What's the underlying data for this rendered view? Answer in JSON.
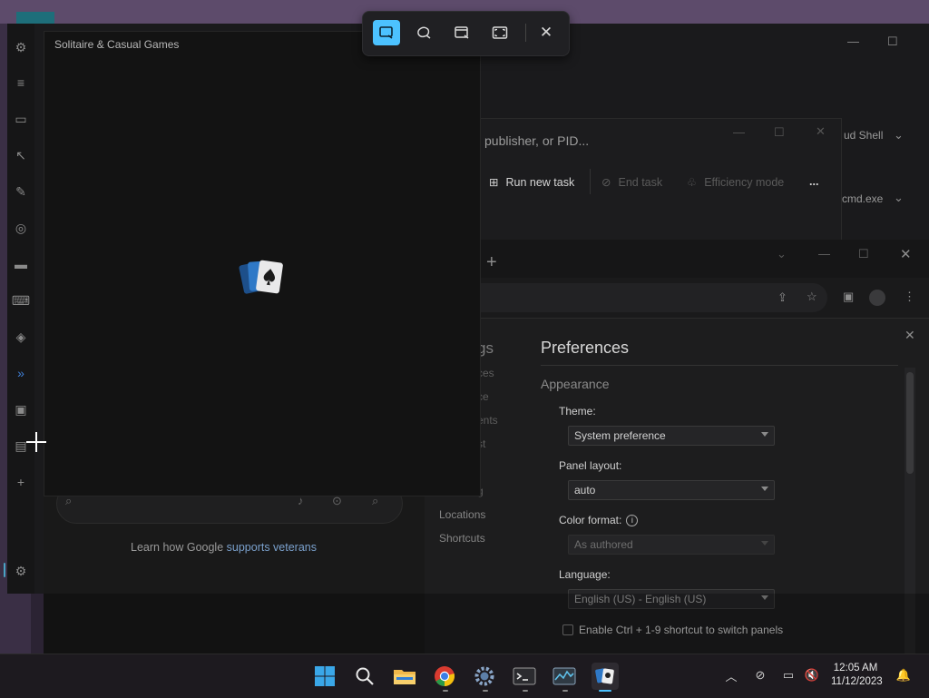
{
  "snip_toolbar": {
    "modes": [
      {
        "name": "rectangle-snip",
        "active": true
      },
      {
        "name": "freeform-snip",
        "active": false
      },
      {
        "name": "window-snip",
        "active": false
      },
      {
        "name": "fullscreen-snip",
        "active": false
      }
    ],
    "close_icon": "close-icon"
  },
  "solitaire": {
    "title": "Solitaire & Casual Games"
  },
  "task_manager": {
    "search_placeholder": "publisher, or PID...",
    "toolbar": {
      "run_new_task": "Run new task",
      "end_task": "End task",
      "efficiency_mode": "Efficiency mode",
      "more": "..."
    },
    "right_items": [
      "ud Shell",
      "cmd.exe"
    ]
  },
  "chrome": {
    "new_tab_symbol": "+",
    "devtools_sidebar_partial": [
      "gs",
      "ces",
      "ce",
      "ents",
      "st",
      "g"
    ],
    "devtools_sidebar": [
      "Locations",
      "Shortcuts"
    ]
  },
  "preferences": {
    "title": "Preferences",
    "section": "Appearance",
    "fields": [
      {
        "label": "Theme:",
        "value": "System preference"
      },
      {
        "label": "Panel layout:",
        "value": "auto"
      },
      {
        "label": "Color format:",
        "value": "As authored",
        "has_info_icon": true
      },
      {
        "label": "Language:",
        "value": "English (US) - English (US)"
      }
    ],
    "checkbox_label": "Enable Ctrl + 1-9 shortcut to switch panels"
  },
  "google": {
    "footer_prefix": "Learn how Google ",
    "footer_link": "supports veterans"
  },
  "taskbar": {
    "apps": [
      "start-icon",
      "search-icon",
      "file-explorer-icon",
      "chrome-icon",
      "settings-icon",
      "terminal-icon",
      "task-manager-icon",
      "solitaire-icon"
    ],
    "clock": {
      "time": "12:05 AM",
      "date": "11/12/2023"
    }
  },
  "colors": {
    "accent": "#4cc2ff",
    "background": "#1a1a1c"
  }
}
